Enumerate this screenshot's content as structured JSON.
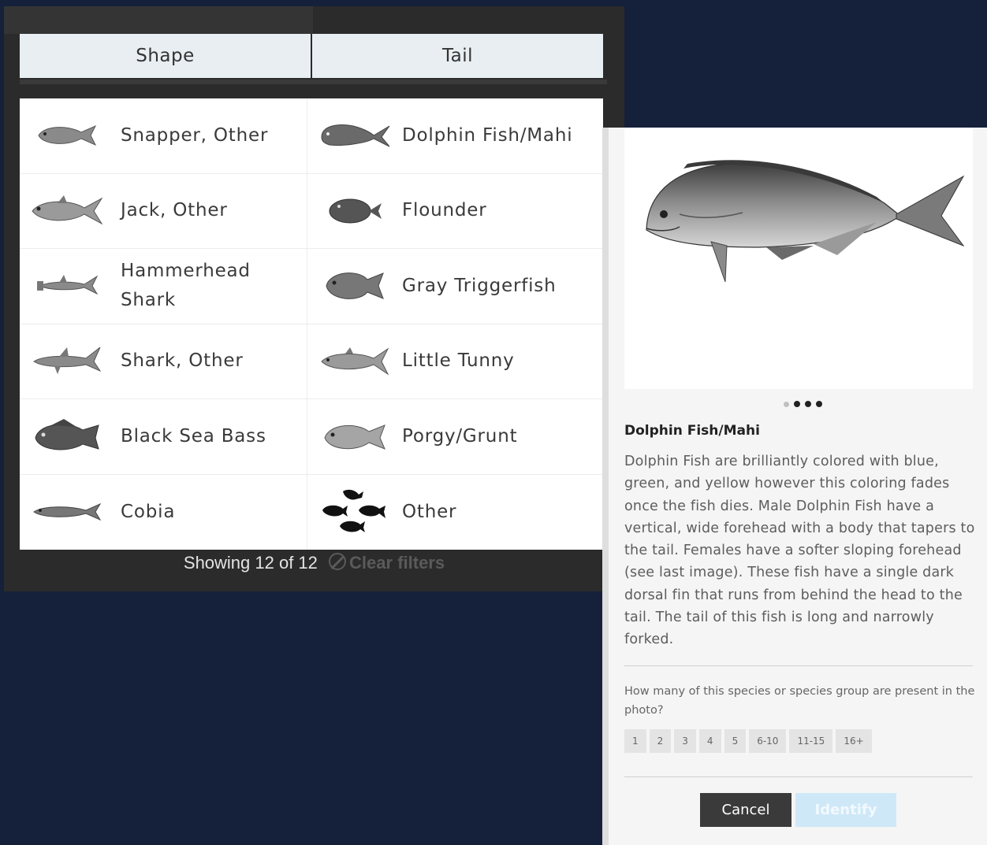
{
  "filters": {
    "tabs": [
      "Shape",
      "Tail"
    ]
  },
  "species": [
    {
      "name": "Snapper, Other",
      "icon": "snapper-icon"
    },
    {
      "name": "Dolphin Fish/Mahi",
      "icon": "dolphin-fish-icon"
    },
    {
      "name": "Jack, Other",
      "icon": "jack-icon"
    },
    {
      "name": "Flounder",
      "icon": "flounder-icon"
    },
    {
      "name": "Hammerhead Shark",
      "icon": "hammerhead-icon"
    },
    {
      "name": "Gray Triggerfish",
      "icon": "triggerfish-icon"
    },
    {
      "name": "Shark, Other",
      "icon": "shark-icon"
    },
    {
      "name": "Little Tunny",
      "icon": "tunny-icon"
    },
    {
      "name": "Black Sea Bass",
      "icon": "sea-bass-icon"
    },
    {
      "name": "Porgy/Grunt",
      "icon": "porgy-icon"
    },
    {
      "name": "Cobia",
      "icon": "cobia-icon"
    },
    {
      "name": "Other",
      "icon": "other-fish-icon"
    }
  ],
  "footer": {
    "showing": "Showing 12 of 12",
    "clear": "Clear filters"
  },
  "detail": {
    "title": "Dolphin Fish/Mahi",
    "description": "Dolphin Fish are brilliantly colored with blue, green, and yellow however this coloring fades once the fish dies. Male Dolphin Fish have a vertical, wide forehead with a body that tapers to the tail. Females have a softer sloping forehead (see last image). These fish have a single dark dorsal fin that runs from behind the head to the tail. The tail of this fish is long and narrowly forked.",
    "question": "How many of this species or species group are present in the photo?",
    "count_options": [
      "1",
      "2",
      "3",
      "4",
      "5",
      "6-10",
      "11-15",
      "16+"
    ],
    "carousel": {
      "total": 4,
      "active": 1
    },
    "cancel": "Cancel",
    "identify": "Identify"
  },
  "colors": {
    "background": "#15213a",
    "identify_disabled": "#cfe8f8",
    "panel": "#2b2b2b"
  }
}
